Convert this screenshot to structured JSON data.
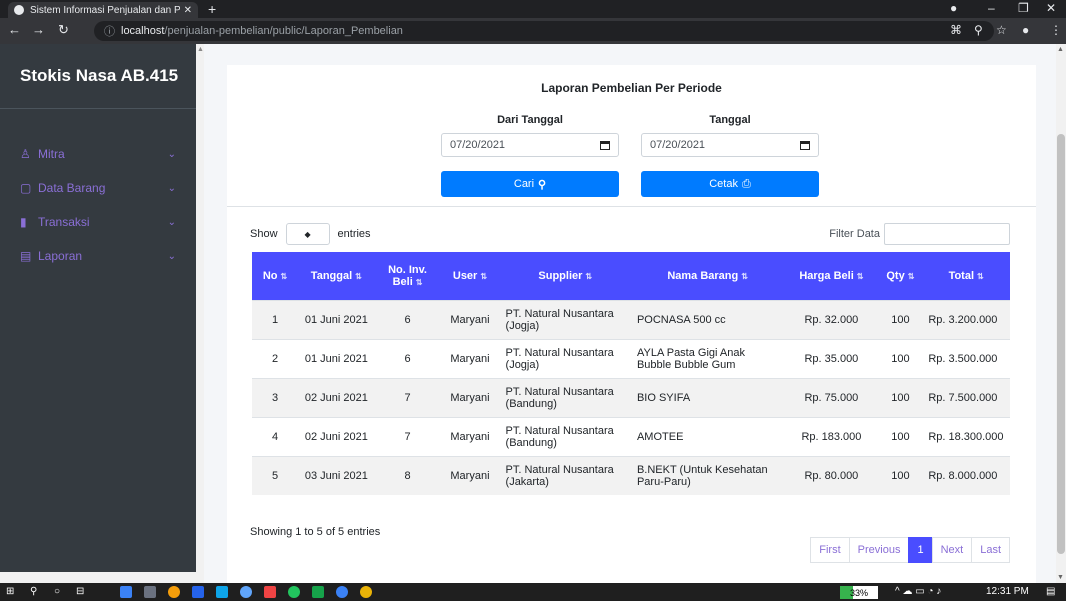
{
  "browser": {
    "tab_title": "Sistem Informasi Penjualan dan P",
    "url_host": "localhost",
    "url_path": "/penjualan-pembelian/public/Laporan_Pembelian"
  },
  "sidebar": {
    "brand": "Stokis Nasa AB.415",
    "items": [
      {
        "label": "Mitra",
        "icon": "user-icon"
      },
      {
        "label": "Data Barang",
        "icon": "box-icon"
      },
      {
        "label": "Transaksi",
        "icon": "chart-icon"
      },
      {
        "label": "Laporan",
        "icon": "report-icon"
      }
    ]
  },
  "filter": {
    "title": "Laporan Pembelian Per Periode",
    "from_label": "Dari Tanggal",
    "to_label": "Tanggal",
    "from_value": "07/20/2021",
    "to_value": "07/20/2021",
    "search_label": "Cari",
    "print_label": "Cetak"
  },
  "table": {
    "show_label": "Show",
    "entries_label": "entries",
    "filter_label": "Filter Data",
    "headers": [
      "No",
      "Tanggal",
      "No. Inv. Beli",
      "User",
      "Supplier",
      "Nama Barang",
      "Harga Beli",
      "Qty",
      "Total"
    ],
    "rows": [
      [
        "1",
        "01 Juni 2021",
        "6",
        "Maryani",
        "PT. Natural Nusantara (Jogja)",
        "POCNASA 500 cc",
        "Rp. 32.000",
        "100",
        "Rp. 3.200.000"
      ],
      [
        "2",
        "01 Juni 2021",
        "6",
        "Maryani",
        "PT. Natural Nusantara (Jogja)",
        "AYLA Pasta Gigi Anak Bubble Bubble Gum",
        "Rp. 35.000",
        "100",
        "Rp. 3.500.000"
      ],
      [
        "3",
        "02 Juni 2021",
        "7",
        "Maryani",
        "PT. Natural Nusantara (Bandung)",
        "BIO SYIFA",
        "Rp. 75.000",
        "100",
        "Rp. 7.500.000"
      ],
      [
        "4",
        "02 Juni 2021",
        "7",
        "Maryani",
        "PT. Natural Nusantara (Bandung)",
        "AMOTEE",
        "Rp. 183.000",
        "100",
        "Rp. 18.300.000"
      ],
      [
        "5",
        "03 Juni 2021",
        "8",
        "Maryani",
        "PT. Natural Nusantara (Jakarta)",
        "B.NEKT (Untuk Kesehatan Paru-Paru)",
        "Rp. 80.000",
        "100",
        "Rp. 8.000.000"
      ]
    ],
    "info": "Showing 1 to 5 of 5 entries",
    "pager": {
      "first": "First",
      "previous": "Previous",
      "current": "1",
      "next": "Next",
      "last": "Last"
    }
  },
  "taskbar": {
    "battery": "33%",
    "battery_level": 0.33,
    "time": "12:31 PM"
  },
  "colors": {
    "sidebar": "#343a40",
    "primary_button": "#007bff",
    "table_header": "#4a4dff",
    "menu_accent": "#8a6fd6"
  }
}
